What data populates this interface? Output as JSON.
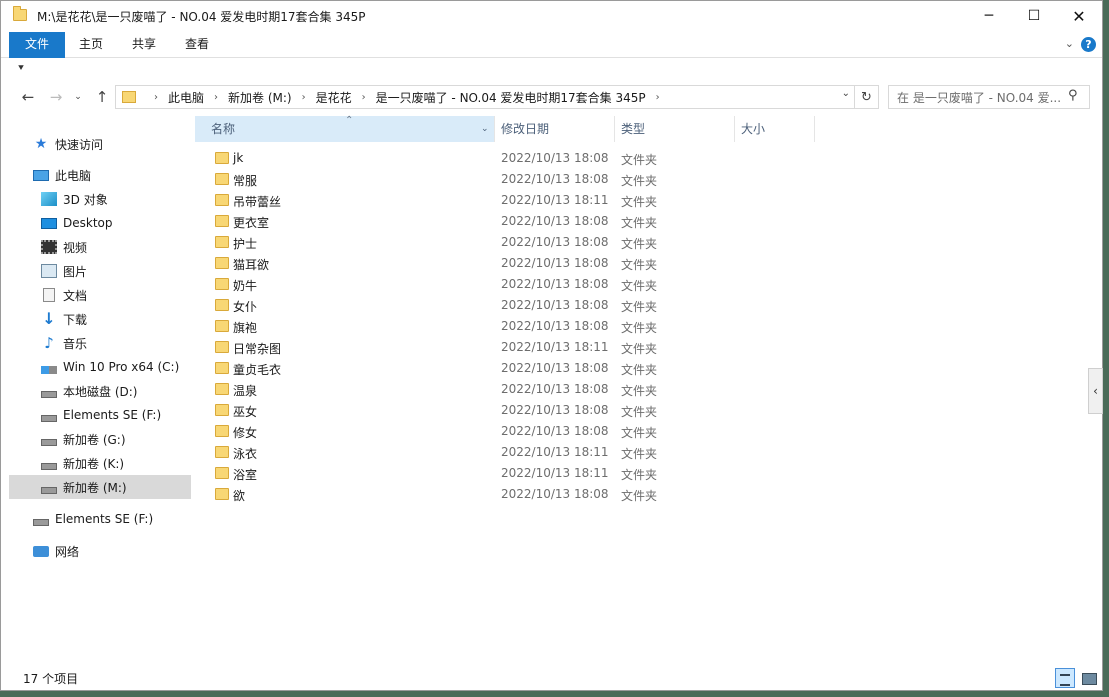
{
  "window": {
    "title": "M:\\是花花\\是一只废喵了 - NO.04 爱发电时期17套合集 345P",
    "minimize": "─",
    "maximize": "☐",
    "close": "✕"
  },
  "ribbon": {
    "tabs": [
      "文件",
      "主页",
      "共享",
      "查看"
    ],
    "expand": "⌄",
    "help": "?"
  },
  "quick_access_toolbar": "⯆",
  "nav": {
    "back": "←",
    "forward": "→",
    "recent": "⌄",
    "up": "↑"
  },
  "address": {
    "crumbs": [
      "此电脑",
      "新加卷 (M:)",
      "是花花",
      "是一只废喵了 - NO.04 爱发电时期17套合集 345P"
    ],
    "separator": "›",
    "dropdown": "⌄",
    "refresh": "↻"
  },
  "search": {
    "placeholder": "在 是一只废喵了 - NO.04 爱...",
    "icon": "⚲"
  },
  "sidebar": {
    "items": [
      {
        "label": "快速访问",
        "icon": "star-icon"
      },
      {
        "label": "此电脑",
        "icon": "pc-icon"
      },
      {
        "label": "3D 对象",
        "icon": "3d-objects-icon"
      },
      {
        "label": "Desktop",
        "icon": "desktop-icon"
      },
      {
        "label": "视频",
        "icon": "video-icon"
      },
      {
        "label": "图片",
        "icon": "pictures-icon"
      },
      {
        "label": "文档",
        "icon": "documents-icon"
      },
      {
        "label": "下载",
        "icon": "downloads-icon"
      },
      {
        "label": "音乐",
        "icon": "music-icon"
      },
      {
        "label": "Win 10 Pro x64 (C:)",
        "icon": "windows-drive-icon"
      },
      {
        "label": "本地磁盘 (D:)",
        "icon": "drive-icon"
      },
      {
        "label": "Elements SE (F:)",
        "icon": "drive-icon"
      },
      {
        "label": "新加卷 (G:)",
        "icon": "drive-icon"
      },
      {
        "label": "新加卷 (K:)",
        "icon": "drive-icon"
      },
      {
        "label": "新加卷 (M:)",
        "icon": "drive-icon"
      },
      {
        "label": "Elements SE (F:)",
        "icon": "drive-icon"
      },
      {
        "label": "网络",
        "icon": "network-icon"
      }
    ]
  },
  "columns": {
    "name": "名称",
    "date": "修改日期",
    "type": "类型",
    "size": "大小",
    "sort_indicator": "⌃",
    "dropdown": "⌄"
  },
  "files": [
    {
      "name": "jk",
      "date": "2022/10/13 18:08",
      "type": "文件夹"
    },
    {
      "name": "常服",
      "date": "2022/10/13 18:08",
      "type": "文件夹"
    },
    {
      "name": "吊带蕾丝",
      "date": "2022/10/13 18:11",
      "type": "文件夹"
    },
    {
      "name": "更衣室",
      "date": "2022/10/13 18:08",
      "type": "文件夹"
    },
    {
      "name": "护士",
      "date": "2022/10/13 18:08",
      "type": "文件夹"
    },
    {
      "name": "猫耳欲",
      "date": "2022/10/13 18:08",
      "type": "文件夹"
    },
    {
      "name": "奶牛",
      "date": "2022/10/13 18:08",
      "type": "文件夹"
    },
    {
      "name": "女仆",
      "date": "2022/10/13 18:08",
      "type": "文件夹"
    },
    {
      "name": "旗袍",
      "date": "2022/10/13 18:08",
      "type": "文件夹"
    },
    {
      "name": "日常杂图",
      "date": "2022/10/13 18:11",
      "type": "文件夹"
    },
    {
      "name": "童贞毛衣",
      "date": "2022/10/13 18:08",
      "type": "文件夹"
    },
    {
      "name": "温泉",
      "date": "2022/10/13 18:08",
      "type": "文件夹"
    },
    {
      "name": "巫女",
      "date": "2022/10/13 18:08",
      "type": "文件夹"
    },
    {
      "name": "修女",
      "date": "2022/10/13 18:08",
      "type": "文件夹"
    },
    {
      "name": "泳衣",
      "date": "2022/10/13 18:11",
      "type": "文件夹"
    },
    {
      "name": "浴室",
      "date": "2022/10/13 18:11",
      "type": "文件夹"
    },
    {
      "name": "欲",
      "date": "2022/10/13 18:08",
      "type": "文件夹"
    }
  ],
  "status": {
    "item_count": "17 个项目"
  },
  "pane_toggle": "‹"
}
